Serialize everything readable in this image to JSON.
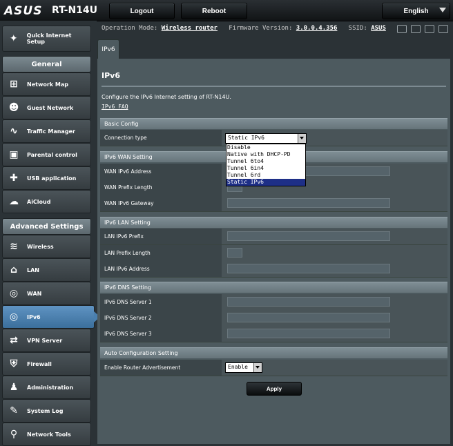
{
  "header": {
    "logo": "ASUS",
    "model": "RT-N14U",
    "logout_label": "Logout",
    "reboot_label": "Reboot",
    "language": "English"
  },
  "status": {
    "op_mode_label": "Operation Mode:",
    "op_mode_value": "Wireless router",
    "firmware_label": "Firmware Version:",
    "firmware_value": "3.0.0.4.356",
    "ssid_label": "SSID:",
    "ssid_value": "ASUS"
  },
  "sidebar": {
    "quick_setup": "Quick Internet Setup",
    "general_header": "General",
    "general_items": [
      {
        "label": "Network Map",
        "icon": "network-map-icon"
      },
      {
        "label": "Guest Network",
        "icon": "guest-network-icon"
      },
      {
        "label": "Traffic Manager",
        "icon": "traffic-manager-icon"
      },
      {
        "label": "Parental control",
        "icon": "parental-control-icon"
      },
      {
        "label": "USB application",
        "icon": "usb-application-icon"
      },
      {
        "label": "AiCloud",
        "icon": "aicloud-icon"
      }
    ],
    "advanced_header": "Advanced Settings",
    "advanced_items": [
      {
        "label": "Wireless",
        "icon": "wireless-icon"
      },
      {
        "label": "LAN",
        "icon": "lan-icon"
      },
      {
        "label": "WAN",
        "icon": "wan-icon"
      },
      {
        "label": "IPv6",
        "icon": "ipv6-icon"
      },
      {
        "label": "VPN Server",
        "icon": "vpn-server-icon"
      },
      {
        "label": "Firewall",
        "icon": "firewall-icon"
      },
      {
        "label": "Administration",
        "icon": "administration-icon"
      },
      {
        "label": "System Log",
        "icon": "system-log-icon"
      },
      {
        "label": "Network Tools",
        "icon": "network-tools-icon"
      }
    ]
  },
  "main": {
    "tab": "IPv6",
    "title": "IPv6",
    "description": "Configure the IPv6 Internet setting of RT-N14U.",
    "faq_link": "IPv6 FAQ",
    "basic_config": {
      "header": "Basic Config",
      "connection_type_label": "Connection type",
      "connection_type_value": "Static IPv6",
      "options": [
        "Disable",
        "Native with DHCP-PD",
        "Tunnel 6to4",
        "Tunnel 6in4",
        "Tunnel 6rd",
        "Static IPv6"
      ]
    },
    "wan": {
      "header": "IPv6 WAN Setting",
      "address_label": "WAN IPv6 Address",
      "prefix_label": "WAN Prefix Length",
      "gateway_label": "WAN IPv6 Gateway"
    },
    "lan": {
      "header": "IPv6 LAN Setting",
      "prefix_label": "LAN IPv6 Prefix",
      "prefix_length_label": "LAN Prefix Length",
      "address_label": "LAN IPv6 Address"
    },
    "dns": {
      "header": "IPv6 DNS Setting",
      "server1_label": "IPv6 DNS Server 1",
      "server2_label": "IPv6 DNS Server 2",
      "server3_label": "IPv6 DNS Server 3"
    },
    "auto": {
      "header": "Auto Configuration Setting",
      "router_adv_label": "Enable Router Advertisement",
      "router_adv_value": "Enable"
    },
    "apply_label": "Apply"
  }
}
